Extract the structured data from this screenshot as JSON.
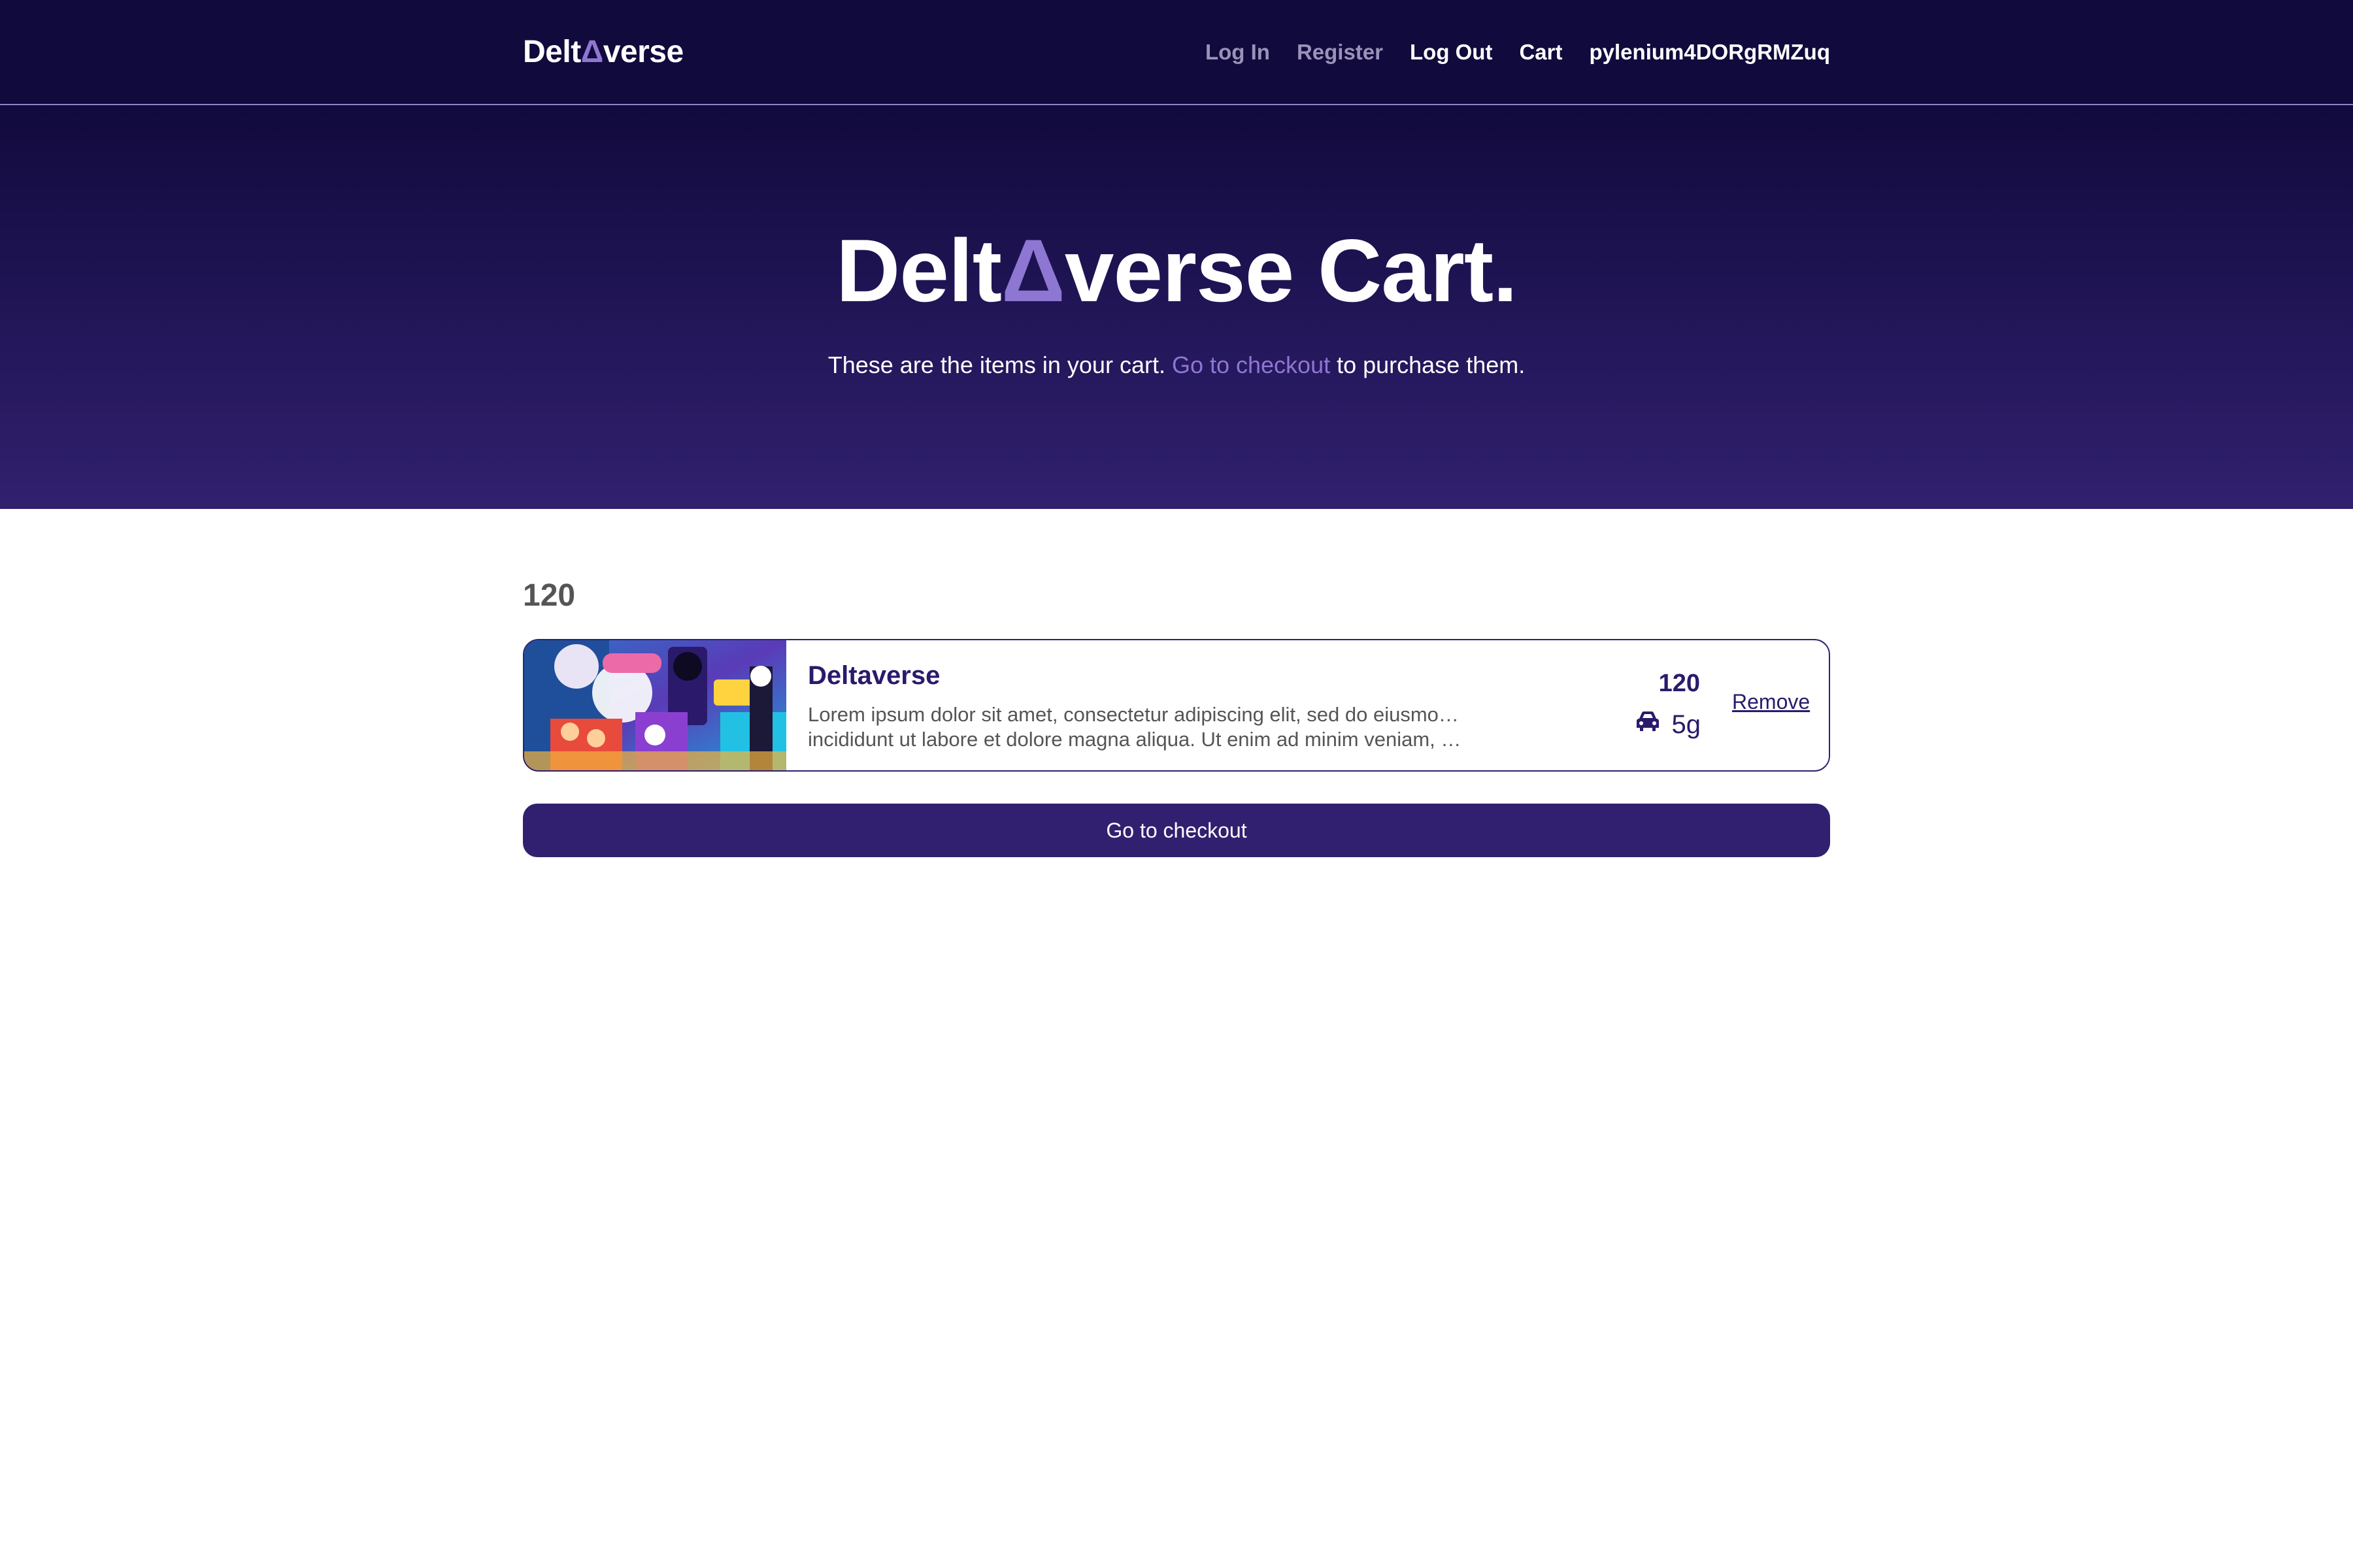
{
  "nav": {
    "logo_pre": "Delt",
    "logo_delta": "Δ",
    "logo_post": "verse",
    "links": {
      "login": "Log In",
      "register": "Register",
      "logout": "Log Out",
      "cart": "Cart",
      "username": "pylenium4DORgRMZuq"
    }
  },
  "hero": {
    "title_pre": "Delt",
    "title_delta": "Δ",
    "title_post": "verse Cart.",
    "sub_before": "These are the items in your cart. ",
    "sub_link": "Go to checkout",
    "sub_after": " to purchase them."
  },
  "cart": {
    "total": "120",
    "items": [
      {
        "title": "Deltaverse",
        "desc_line1": "Lorem ipsum dolor sit amet, consectetur adipiscing elit, sed do eiusmod tempor",
        "desc_line2": "incididunt ut labore et dolore magna aliqua. Ut enim ad minim veniam, quis nostrud exercitation",
        "price": "120",
        "weight": "5g",
        "weight_icon": "car-icon",
        "remove_label": "Remove"
      }
    ],
    "checkout_label": "Go to checkout"
  },
  "colors": {
    "nav_bg": "#110a3d",
    "hero_bottom": "#31206f",
    "accent": "#8e76d3",
    "primary": "#31206f",
    "item_text": "#2b1a6b"
  }
}
